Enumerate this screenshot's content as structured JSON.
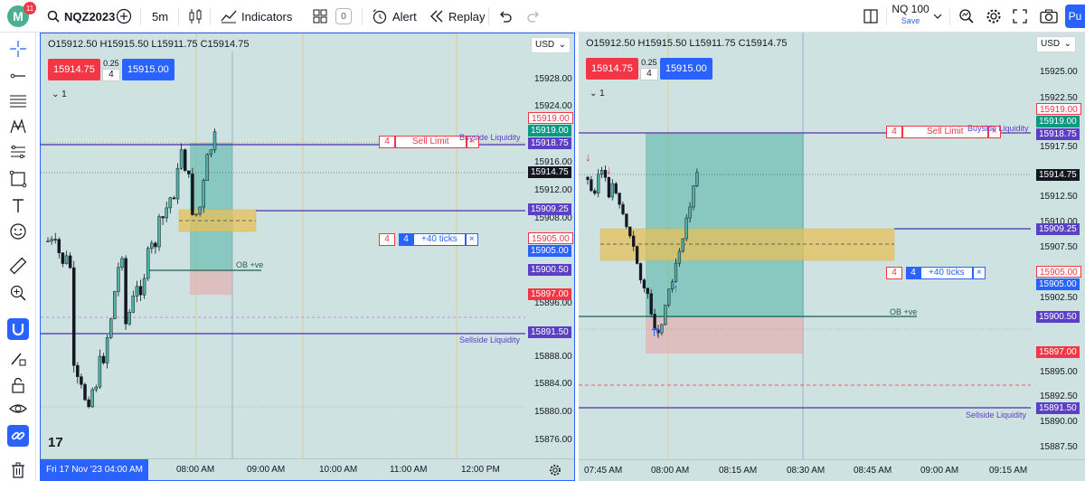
{
  "app": {
    "logo_letter": "M",
    "notifications": "11"
  },
  "toolbar": {
    "symbol": "NQZ2023",
    "interval": "5m",
    "indicators_label": "Indicators",
    "templates_count": "0",
    "alert_label": "Alert",
    "replay_label": "Replay",
    "layout_name": "NQ 100",
    "layout_status": "Save",
    "publish_label": "Pu"
  },
  "colors": {
    "accent": "#2962ff",
    "sell": "#f23645",
    "buy": "#2962ff",
    "chart_bg": "#cfe2e2",
    "liquidity": "#5b3fc4",
    "ob_zone": "#e8c15a"
  },
  "left_toolbar": [
    "crosshair-icon",
    "trend-line-icon",
    "fib-icon",
    "pattern-icon",
    "prediction-icon",
    "shapes-icon",
    "text-icon",
    "emoji-icon",
    "ruler-icon",
    "zoom-in-icon",
    "magnet-icon",
    "lock-drawing-icon",
    "lock-icon",
    "eye-icon",
    "link-icon",
    "trash-icon"
  ],
  "pane1": {
    "ohlc": "O15912.50 H15915.50 L15911.75 C15914.75",
    "sell_price": "15914.75",
    "buy_price": "15915.00",
    "spread": "0.25",
    "qty": "4",
    "collapse": "1",
    "currency": "USD",
    "price_ticks": [
      "15928.00",
      "15924.00",
      "15916.00",
      "15912.00",
      "15908.00",
      "15896.00",
      "15888.00",
      "15884.00",
      "15880.00",
      "15876.00"
    ],
    "price_labels": {
      "sell_limit": "15919.00",
      "tp_line": "15919.00",
      "buyside": "15918.75",
      "last": "15914.75",
      "ob_top": "15909.25",
      "target_line": "15905.00",
      "target_tp": "15905.00",
      "ob_line": "15900.50",
      "stop": "15897.00",
      "sellside": "15891.50"
    },
    "order_sell_limit": {
      "qty": "4",
      "label": "Sell Limit",
      "close": "×"
    },
    "order_tp": {
      "qty": "4",
      "qty_inner": "4",
      "label": "+40 ticks",
      "close": "×"
    },
    "buyside_label": "Buyside Liquidity",
    "sellside_label": "Sellside Liquidity",
    "ob_label": "OB +ve",
    "date_label": "Fri 17 Nov '23   04:00 AM",
    "time_ticks": [
      "08:00 AM",
      "09:00 AM",
      "10:00 AM",
      "11:00 AM",
      "12:00 PM"
    ]
  },
  "pane2": {
    "ohlc": "O15912.50 H15915.50 L15911.75 C15914.75",
    "sell_price": "15914.75",
    "buy_price": "15915.00",
    "spread": "0.25",
    "qty": "4",
    "collapse": "1",
    "currency": "USD",
    "price_ticks": [
      "15925.00",
      "15922.50",
      "15917.50",
      "15912.50",
      "15910.00",
      "15907.50",
      "15902.50",
      "15895.00",
      "15892.50",
      "15890.00",
      "15887.50"
    ],
    "price_labels": {
      "sell_limit": "15919.00",
      "tp_line": "15919.00",
      "buyside": "15918.75",
      "last": "15914.75",
      "ob_top": "15909.25",
      "target_line": "15905.00",
      "target_tp": "15905.00",
      "ob_line": "15900.50",
      "stop": "15897.00",
      "sellside": "15891.50"
    },
    "order_sell_limit": {
      "qty": "4",
      "label": "Sell Limit",
      "close": "×"
    },
    "order_tp": {
      "qty": "4",
      "qty_inner": "4",
      "label": "+40 ticks",
      "close": "×"
    },
    "buyside_label": "Buyside Liquidity",
    "sellside_label": "Sellside Liquidity",
    "ob_label": "OB +ve",
    "time_ticks": [
      "07:45 AM",
      "08:00 AM",
      "08:15 AM",
      "08:30 AM",
      "08:45 AM",
      "09:00 AM",
      "09:15 AM"
    ]
  }
}
